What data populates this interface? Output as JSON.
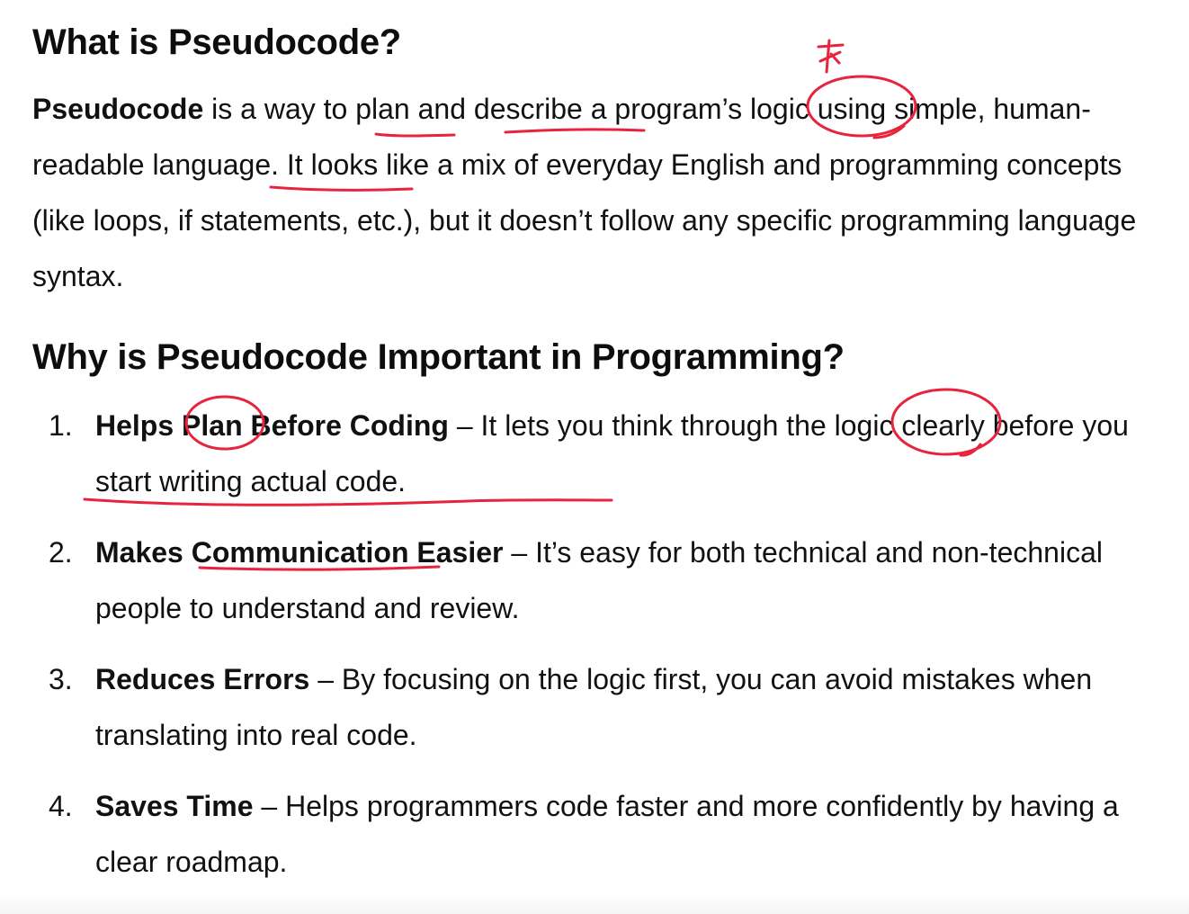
{
  "heading1": "What is Pseudocode?",
  "intro": {
    "bold_term": "Pseudocode",
    "text": " is a way to plan and describe a program’s logic using simple, human-readable language. It looks like a mix of everyday English and programming concepts (like loops, if statements, etc.), but it doesn’t follow any specific programming language syntax."
  },
  "heading2": "Why is Pseudocode Important in Programming?",
  "items": [
    {
      "number": "1.",
      "title": "Helps Plan Before Coding",
      "text": " – It lets you think through the logic clearly before you start writing actual code."
    },
    {
      "number": "2.",
      "title": "Makes Communication Easier",
      "text": " – It’s easy for both technical and non-technical people to understand and review."
    },
    {
      "number": "3.",
      "title": "Reduces Errors",
      "text": " – By focusing on the logic first, you can avoid mistakes when translating into real code."
    },
    {
      "number": "4.",
      "title": "Saves Time",
      "text": " – Helps programmers code faster and more confidently by having a clear roadmap."
    }
  ],
  "colors": {
    "text": "#111111",
    "annotation": "#e8233e",
    "background": "#ffffff"
  }
}
